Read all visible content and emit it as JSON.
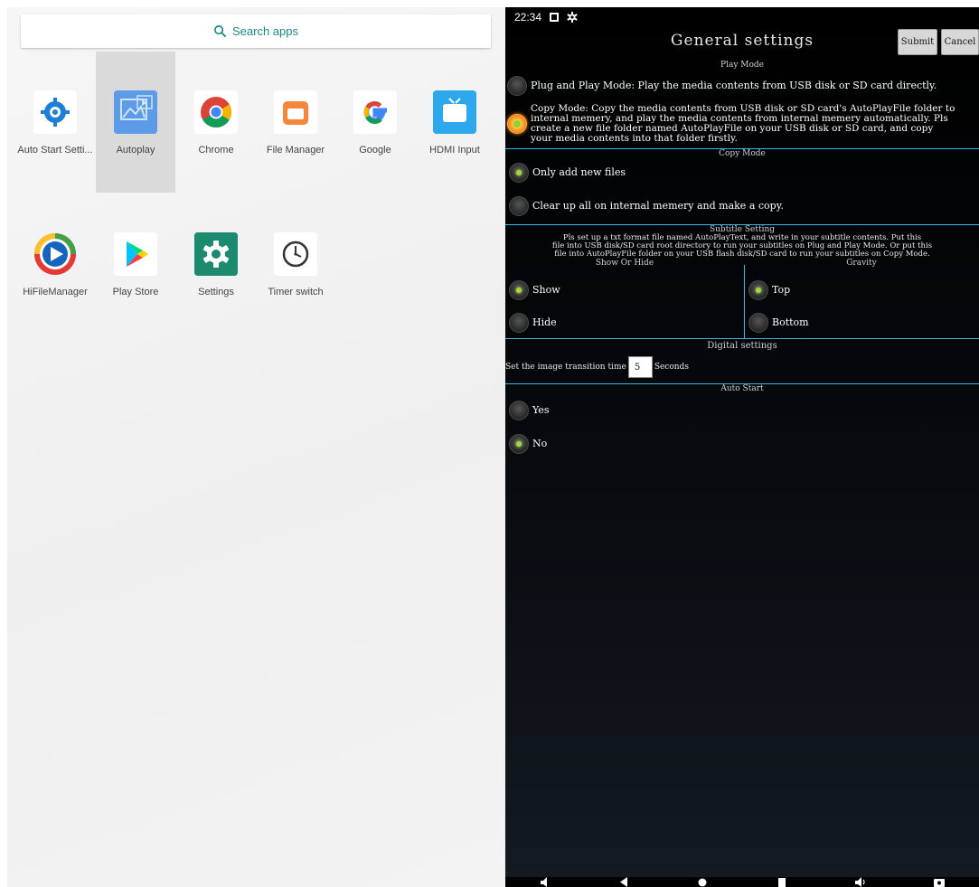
{
  "launcher": {
    "search_label": "Search apps",
    "apps": [
      {
        "label": "Auto Start Setti...",
        "icon": "auto-start-settings-icon"
      },
      {
        "label": "Autoplay",
        "icon": "autoplay-icon",
        "selected": true
      },
      {
        "label": "Chrome",
        "icon": "chrome-icon"
      },
      {
        "label": "File Manager",
        "icon": "file-manager-icon"
      },
      {
        "label": "Google",
        "icon": "google-icon"
      },
      {
        "label": "HDMI Input",
        "icon": "hdmi-input-icon"
      },
      {
        "label": "HiFileManager",
        "icon": "hifilemanager-icon"
      },
      {
        "label": "Play Store",
        "icon": "play-store-icon"
      },
      {
        "label": "Settings",
        "icon": "settings-gear-icon"
      },
      {
        "label": "Timer switch",
        "icon": "timer-clock-icon"
      }
    ]
  },
  "status_bar": {
    "time": "22:34"
  },
  "settings": {
    "title": "General settings",
    "submit_label": "Submit",
    "cancel_label": "Cancel",
    "play_mode": {
      "header": "Play Mode",
      "plug_play": "Plug and Play Mode: Play the media contents from USB disk or SD card directly.",
      "copy_mode_lines": [
        "Copy Mode: Copy the media contents from USB disk or SD card's AutoPlayFile folder to",
        "internal memery, and play the media contents from internal memery automatically. Pls",
        "create a new file folder named AutoPlayFile on your USB disk or SD card, and copy",
        "your media contents into that folder firstly."
      ]
    },
    "copy_mode": {
      "header": "Copy Mode",
      "only_new": "Only add new files",
      "clear_all": "Clear up all on internal memery and make a copy."
    },
    "subtitle": {
      "header": "Subtitle Setting",
      "desc_lines": [
        "Pls set up a txt format file named AutoPlayText, and write in your subtitle contents. Put this",
        "file into USB disk/SD card root directory to run your subtitles on Plug and Play Mode. Or put this",
        "file into AutoPlayFile folder on your USB flash disk/SD card to run your subtitles on Copy Mode."
      ],
      "show_hide_header": "Show Or Hide",
      "gravity_header": "Gravity",
      "show": "Show",
      "hide": "Hide",
      "top": "Top",
      "bottom": "Bottom"
    },
    "digital": {
      "header": "Digital settings",
      "prefix": "Set the image transition time",
      "value": "5",
      "suffix": "Seconds"
    },
    "auto_start": {
      "header": "Auto Start",
      "yes": "Yes",
      "no": "No"
    }
  }
}
